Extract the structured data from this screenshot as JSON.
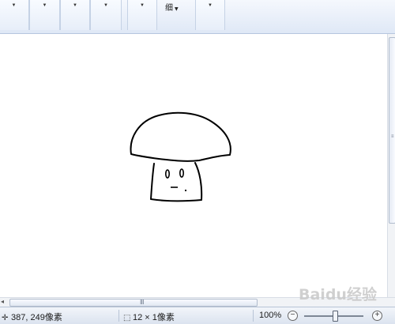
{
  "ribbon": {
    "groups": [
      {
        "id": "g1",
        "icon": "dropdown-arrow"
      },
      {
        "id": "g2",
        "icon": "dropdown-arrow"
      },
      {
        "id": "g3",
        "icon": "dropdown-arrow"
      },
      {
        "id": "g4",
        "icon": "dropdown-arrow"
      },
      {
        "id": "g5",
        "icon": "dropdown-arrow"
      },
      {
        "id": "g6",
        "icon": "dropdown-arrow"
      }
    ],
    "size_label": "细"
  },
  "status": {
    "cursor_position": "387, 249像素",
    "selection_size": "12 × 1像素",
    "zoom_level": "100%",
    "zoom_out": "−",
    "zoom_in": "+",
    "zoom_fraction": 0.5
  },
  "scrollbars": {
    "h_grip": "Ⅲ",
    "v_grip": "≡"
  },
  "watermark": "Baidu经验",
  "colors": {
    "ribbon_bg": "#dfe8f6",
    "canvas_bg": "#ffffff",
    "stroke": "#000000"
  }
}
